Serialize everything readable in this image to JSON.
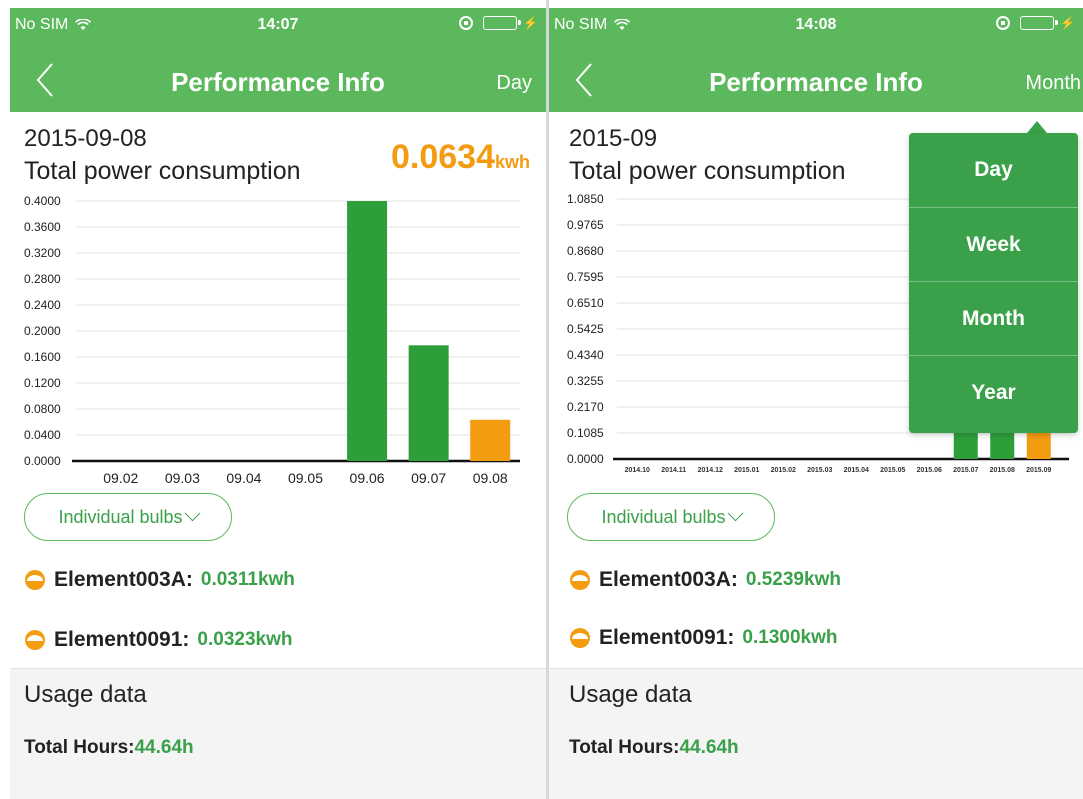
{
  "colors": {
    "green_bar": "#2e9e3b",
    "current_bar": "#f39c12",
    "header": "#5cb85c",
    "value_green": "#3aa14a"
  },
  "screens": [
    {
      "status": {
        "carrier": "No SIM",
        "time": "14:07"
      },
      "nav": {
        "title": "Performance Info",
        "period_button": "Day"
      },
      "date": "2015-09-08",
      "total_label": "Total power consumption",
      "total_value": "0.0634",
      "total_unit": "kwh",
      "bulbs_button": "Individual bulbs",
      "elements": [
        {
          "name": "Element003A:",
          "value": "0.0311kwh"
        },
        {
          "name": "Element0091:",
          "value": "0.0323kwh"
        }
      ],
      "usage": {
        "title": "Usage data",
        "hours_label": "Total Hours:",
        "hours_value": "44.64h"
      }
    },
    {
      "status": {
        "carrier": "No SIM",
        "time": "14:08"
      },
      "nav": {
        "title": "Performance Info",
        "period_button": "Month"
      },
      "date": "2015-09",
      "total_label": "Total power consumption",
      "bulbs_button": "Individual bulbs",
      "elements": [
        {
          "name": "Element003A:",
          "value": "0.5239kwh"
        },
        {
          "name": "Element0091:",
          "value": "0.1300kwh"
        }
      ],
      "usage": {
        "title": "Usage data",
        "hours_label": "Total Hours:",
        "hours_value": "44.64h"
      },
      "period_menu": [
        "Day",
        "Week",
        "Month",
        "Year"
      ]
    }
  ],
  "chart_data": [
    {
      "type": "bar",
      "categories": [
        "09.02",
        "09.03",
        "09.04",
        "09.05",
        "09.06",
        "09.07",
        "09.08"
      ],
      "values": [
        0,
        0,
        0,
        0,
        0.4,
        0.178,
        0.0634
      ],
      "highlight_index": 6,
      "ylim": [
        0,
        0.4
      ],
      "yticks": [
        "0.0000",
        "0.0400",
        "0.0800",
        "0.1200",
        "0.1600",
        "0.2000",
        "0.2400",
        "0.2800",
        "0.3200",
        "0.3600",
        "0.4000"
      ],
      "grid": true
    },
    {
      "type": "bar",
      "categories": [
        "2014.10",
        "2014.11",
        "2014.12",
        "2015.01",
        "2015.02",
        "2015.03",
        "2015.04",
        "2015.05",
        "2015.06",
        "2015.07",
        "2015.08",
        "2015.09"
      ],
      "values": [
        0,
        0,
        0,
        0,
        0,
        0,
        0,
        0,
        0,
        0.2,
        0.15,
        0.11
      ],
      "highlight_index": 11,
      "ylim": [
        0,
        1.085
      ],
      "yticks": [
        "0.0000",
        "0.1085",
        "0.2170",
        "0.3255",
        "0.4340",
        "0.5425",
        "0.6510",
        "0.7595",
        "0.8680",
        "0.9765",
        "1.0850"
      ],
      "grid": true
    }
  ]
}
